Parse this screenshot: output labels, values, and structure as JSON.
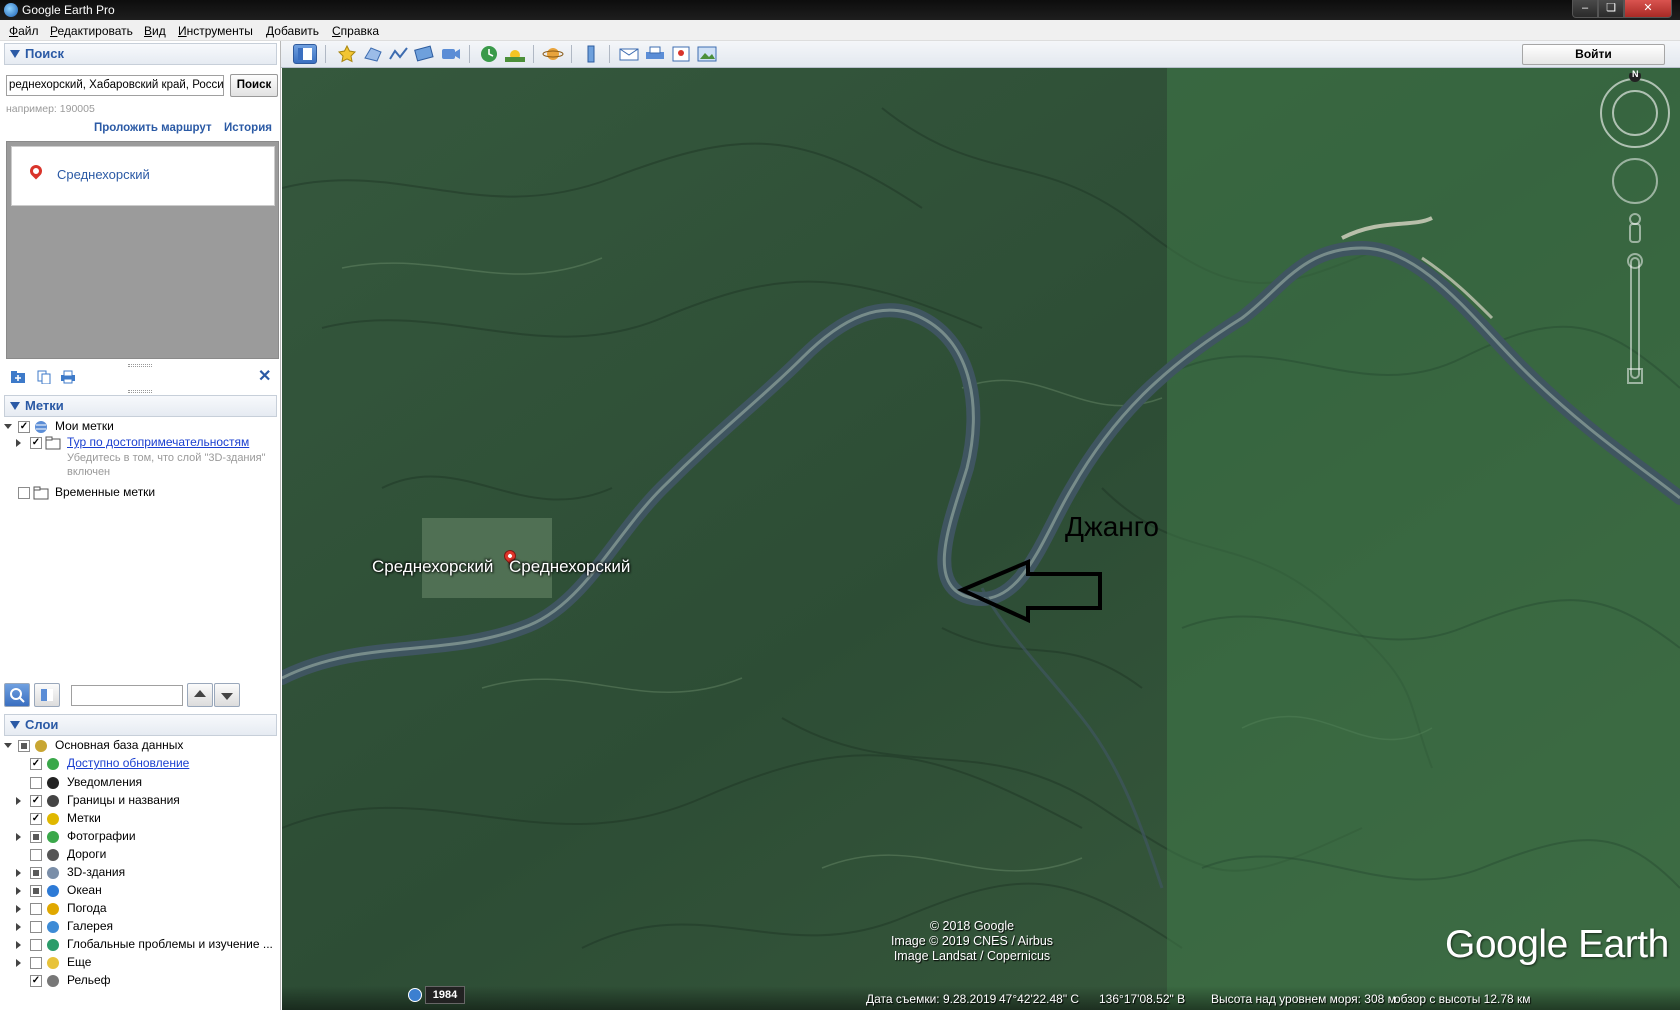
{
  "window": {
    "title": "Google Earth Pro"
  },
  "menu": [
    "Файл",
    "Редактировать",
    "Вид",
    "Инструменты",
    "Добавить",
    "Справка"
  ],
  "toolbar": {
    "signin_label": "Войти"
  },
  "search": {
    "header": "Поиск",
    "query_value": "реднехорский, Хабаровский край, Россия",
    "button_label": "Поиск",
    "example_text": "например: 190005",
    "route_link": "Проложить маршрут",
    "history_link": "История",
    "results": [
      {
        "name": "Среднехорский"
      }
    ]
  },
  "places": {
    "header": "Метки",
    "items": [
      {
        "label": "Мои метки",
        "checked": true,
        "expanded": true,
        "icon": "globe-folder-icon"
      },
      {
        "label": "Тур по достопримечательностям",
        "checked": true,
        "link": true,
        "icon": "folder-icon"
      },
      {
        "label": "Временные метки",
        "checked": false,
        "icon": "folder-icon"
      }
    ],
    "hint_line1": "Убедитесь в том, что слой \"3D-здания\"",
    "hint_line2": "включен"
  },
  "layers": {
    "header": "Слои",
    "items": [
      {
        "label": "Основная база данных",
        "state": "partial",
        "icon": "layers-icon"
      },
      {
        "label": "Доступно обновление",
        "state": "checked",
        "link": true,
        "icon": "update-icon"
      },
      {
        "label": "Уведомления",
        "state": "unchecked",
        "icon": "envelope-icon"
      },
      {
        "label": "Границы и названия",
        "state": "checked",
        "icon": "flag-icon"
      },
      {
        "label": "Метки",
        "state": "checked",
        "icon": "placemark-icon"
      },
      {
        "label": "Фотографии",
        "state": "partial",
        "icon": "photo-icon"
      },
      {
        "label": "Дороги",
        "state": "unchecked",
        "icon": "road-icon"
      },
      {
        "label": "3D-здания",
        "state": "partial",
        "icon": "building-icon"
      },
      {
        "label": "Океан",
        "state": "partial",
        "icon": "ocean-icon"
      },
      {
        "label": "Погода",
        "state": "unchecked",
        "icon": "weather-icon"
      },
      {
        "label": "Галерея",
        "state": "unchecked",
        "icon": "gallery-icon"
      },
      {
        "label": "Глобальные проблемы и изучение ...",
        "state": "unchecked",
        "icon": "globe-icon"
      },
      {
        "label": "Еще",
        "state": "unchecked",
        "icon": "more-icon"
      },
      {
        "label": "Рельеф",
        "state": "checked",
        "icon": "terrain-icon"
      }
    ]
  },
  "map": {
    "labels": {
      "left": "Среднехорский",
      "right": "Среднехорский",
      "annotation": "Джанго"
    },
    "credits": [
      "© 2018 Google",
      "Image © 2019 CNES / Airbus",
      "Image Landsat / Copernicus"
    ],
    "logo": "Google Earth",
    "compass_letter": "N",
    "year": "1984",
    "status": {
      "date": "Дата съемки: 9.28.2019",
      "lat": "47°42'22.48\" С",
      "lon": "136°17'08.52\" В",
      "elevation": "Высота над уровнем моря:   308 м",
      "eye_alt": "обзор с высоты   12.78 км"
    }
  }
}
